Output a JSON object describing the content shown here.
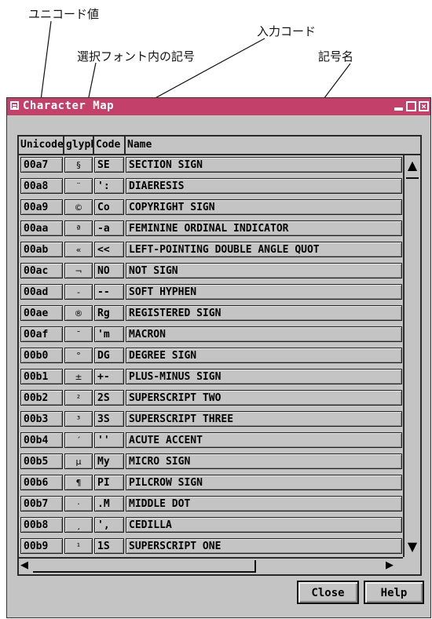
{
  "annotations": {
    "unicode_value": "ユニコード値",
    "input_code": "入力コード",
    "glyph_in_font": "選択フォント内の記号",
    "symbol_name": "記号名"
  },
  "window": {
    "title": "Character Map",
    "title_bar_color": "#c2406a"
  },
  "columns": [
    "Unicode",
    "glyph",
    "Code",
    "Name"
  ],
  "rows": [
    {
      "unicode": "00a7",
      "glyph": "§",
      "code": "SE",
      "name": "SECTION SIGN"
    },
    {
      "unicode": "00a8",
      "glyph": "¨",
      "code": "':",
      "name": "DIAERESIS"
    },
    {
      "unicode": "00a9",
      "glyph": "©",
      "code": "Co",
      "name": "COPYRIGHT SIGN"
    },
    {
      "unicode": "00aa",
      "glyph": "ª",
      "code": "-a",
      "name": "FEMININE ORDINAL INDICATOR"
    },
    {
      "unicode": "00ab",
      "glyph": "«",
      "code": "<<",
      "name": "LEFT-POINTING DOUBLE ANGLE QUOT"
    },
    {
      "unicode": "00ac",
      "glyph": "¬",
      "code": "NO",
      "name": "NOT SIGN"
    },
    {
      "unicode": "00ad",
      "glyph": "-",
      "code": "--",
      "name": "SOFT HYPHEN"
    },
    {
      "unicode": "00ae",
      "glyph": "®",
      "code": "Rg",
      "name": "REGISTERED SIGN"
    },
    {
      "unicode": "00af",
      "glyph": "¯",
      "code": "'m",
      "name": "MACRON"
    },
    {
      "unicode": "00b0",
      "glyph": "°",
      "code": "DG",
      "name": "DEGREE SIGN"
    },
    {
      "unicode": "00b1",
      "glyph": "±",
      "code": "+-",
      "name": "PLUS-MINUS SIGN"
    },
    {
      "unicode": "00b2",
      "glyph": "²",
      "code": "2S",
      "name": "SUPERSCRIPT TWO"
    },
    {
      "unicode": "00b3",
      "glyph": "³",
      "code": "3S",
      "name": "SUPERSCRIPT THREE"
    },
    {
      "unicode": "00b4",
      "glyph": "´",
      "code": "''",
      "name": "ACUTE ACCENT"
    },
    {
      "unicode": "00b5",
      "glyph": "µ",
      "code": "My",
      "name": "MICRO SIGN"
    },
    {
      "unicode": "00b6",
      "glyph": "¶",
      "code": "PI",
      "name": "PILCROW SIGN"
    },
    {
      "unicode": "00b7",
      "glyph": "·",
      "code": ".M",
      "name": "MIDDLE DOT"
    },
    {
      "unicode": "00b8",
      "glyph": "¸",
      "code": "',",
      "name": "CEDILLA"
    },
    {
      "unicode": "00b9",
      "glyph": "¹",
      "code": "1S",
      "name": "SUPERSCRIPT ONE"
    }
  ],
  "buttons": {
    "close": "Close",
    "help": "Help"
  }
}
